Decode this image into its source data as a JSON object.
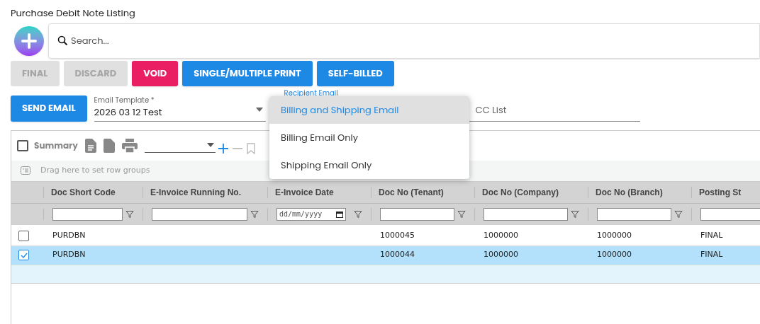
{
  "page_title": "Purchase Debit Note Listing",
  "search": {
    "placeholder": "Search..."
  },
  "actions": [
    {
      "label": "FINAL",
      "kind": "disabled"
    },
    {
      "label": "DISCARD",
      "kind": "disabled"
    },
    {
      "label": "VOID",
      "kind": "danger"
    },
    {
      "label": "SINGLE/MULTIPLE PRINT",
      "kind": "primary"
    },
    {
      "label": "SELF-BILLED",
      "kind": "primary"
    }
  ],
  "send_email": "SEND EMAIL",
  "email_template": {
    "label": "Email Template *",
    "value": "2026 03 12 Test"
  },
  "recipient_email": {
    "label": "Recipient Email"
  },
  "cc_list": {
    "placeholder": "CC List"
  },
  "recipient_menu": [
    {
      "label": "Billing and Shipping Email",
      "selected": true
    },
    {
      "label": "Billing Email Only",
      "selected": false
    },
    {
      "label": "Shipping Email Only",
      "selected": false
    }
  ],
  "toolbar": {
    "summary": {
      "label": "Summary",
      "checked": false
    }
  },
  "group_hint": "Drag here to set row groups",
  "table": {
    "columns": [
      {
        "label": "Doc Short Code",
        "kind": "text"
      },
      {
        "label": "E-Invoice Running No.",
        "kind": "text"
      },
      {
        "label": "E-Invoice Date",
        "kind": "date",
        "placeholder": "dd/mm/yyyy"
      },
      {
        "label": "Doc No (Tenant)",
        "kind": "text"
      },
      {
        "label": "Doc No (Company)",
        "kind": "text"
      },
      {
        "label": "Doc No (Branch)",
        "kind": "text"
      },
      {
        "label": "Posting St",
        "kind": "text"
      }
    ],
    "rows": [
      {
        "selected": false,
        "cells": [
          "PURDBN",
          "",
          "",
          "1000045",
          "1000000",
          "1000000",
          "FINAL"
        ]
      },
      {
        "selected": true,
        "cells": [
          "PURDBN",
          "",
          "",
          "1000044",
          "1000000",
          "1000000",
          "FINAL"
        ]
      }
    ]
  }
}
